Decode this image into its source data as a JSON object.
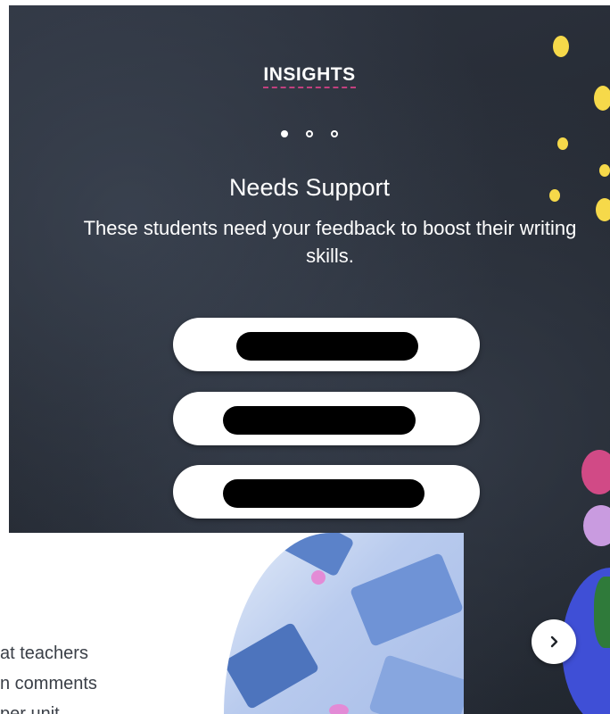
{
  "insights": {
    "title": "INSIGHTS",
    "carousel_total": 3,
    "carousel_active": 1,
    "heading": "Needs Support",
    "description": "These students need your feedback to boost their writing skills.",
    "students": [
      "",
      "",
      ""
    ]
  },
  "card": {
    "text_lines": [
      "at teachers",
      "n comments",
      "per unit"
    ]
  },
  "navigation": {
    "next_icon": "chevron-right-icon"
  },
  "colors": {
    "panel_background": "#252a33",
    "title_underline": "#c2407f",
    "confetti_yellow": "#f6d94a",
    "confetti_pink": "#d14a86",
    "confetti_lavender": "#c99be0",
    "confetti_blue": "#3f4fd6",
    "confetti_green": "#2f7a3a"
  }
}
